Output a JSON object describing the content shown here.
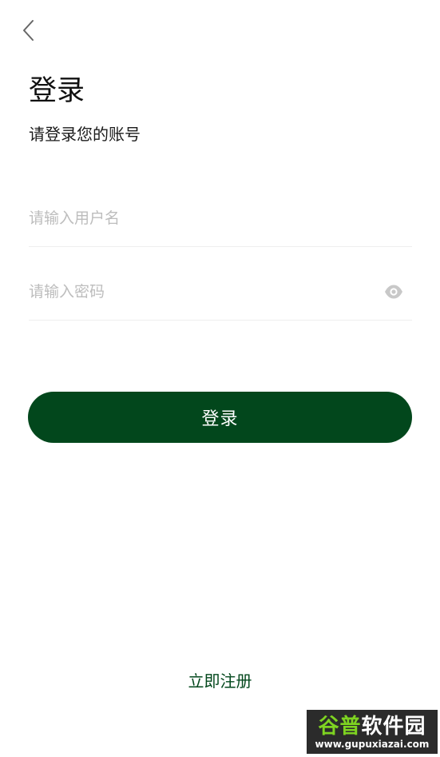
{
  "header": {
    "back_icon": "chevron-left-icon"
  },
  "title": "登录",
  "subtitle": "请登录您的账号",
  "form": {
    "username": {
      "value": "",
      "placeholder": "请输入用户名"
    },
    "password": {
      "value": "",
      "placeholder": "请输入密码",
      "toggle_icon": "eye-icon"
    },
    "login_label": "登录"
  },
  "footer": {
    "register_label": "立即注册"
  },
  "watermark": {
    "brand_part1": "谷普",
    "brand_part2": "软件园",
    "url": "www.gupuxiazai.com"
  },
  "colors": {
    "primary": "#02471c",
    "placeholder": "#bdbdbd",
    "divider": "#eeeeee",
    "icon_gray": "#c8c8c8"
  }
}
